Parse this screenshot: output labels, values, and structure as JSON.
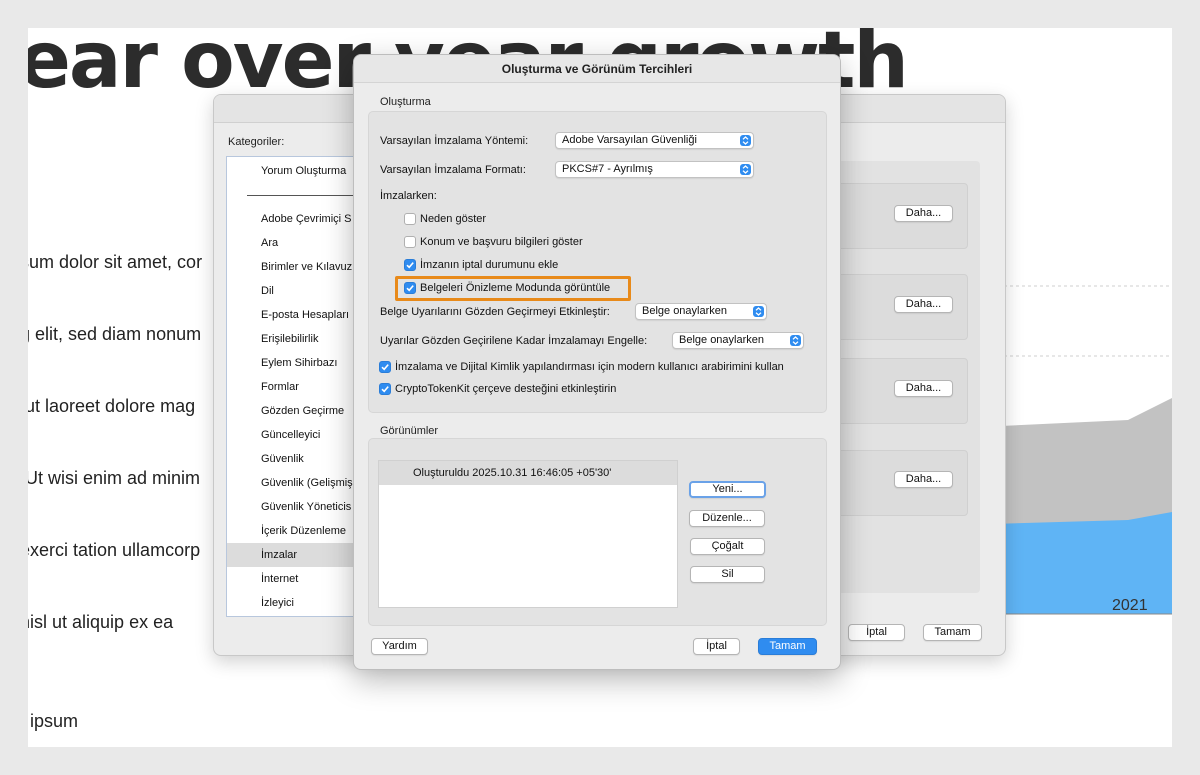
{
  "background_doc": {
    "heading": "ear over year growth",
    "body_lines": [
      "sum dolor sit amet, cor",
      "g elit, sed diam nonum",
      " ut laoreet dolore mag",
      " Ut wisi enim ad minim",
      "exerci tation ullamcorp",
      "nisl ut aliquip ex ea"
    ],
    "footer": "ipsum",
    "chart_year_label": "2021"
  },
  "back_window": {
    "categories_label": "Kategoriler:",
    "categories": [
      "Yorum Oluşturma",
      "Adobe Çevrimiçi S",
      "Ara",
      "Birimler ve Kılavuz",
      "Dil",
      "E-posta Hesapları",
      "Erişilebilirlik",
      "Eylem Sihirbazı",
      "Formlar",
      "Gözden Geçirme",
      "Güncelleyici",
      "Güvenlik",
      "Güvenlik (Gelişmiş",
      "Güvenlik Yöneticis",
      "İçerik Düzenleme",
      "İmzalar",
      "İnternet",
      "İzleyici"
    ],
    "selected_category": "İmzalar",
    "more_buttons": [
      "Daha...",
      "Daha...",
      "Daha...",
      "Daha..."
    ],
    "cancel_label": "İptal",
    "ok_label": "Tamam"
  },
  "dialog": {
    "title": "Oluşturma ve Görünüm Tercihleri",
    "creation_section": "Oluşturma",
    "method_label": "Varsayılan İmzalama Yöntemi:",
    "method_value": "Adobe Varsayılan Güvenliği",
    "format_label": "Varsayılan İmzalama Formatı:",
    "format_value": "PKCS#7 - Ayrılmış",
    "when_signing_label": "İmzalarken:",
    "checks": [
      {
        "label": "Neden göster",
        "checked": false
      },
      {
        "label": "Konum ve başvuru bilgileri göster",
        "checked": false
      },
      {
        "label": "İmzanın iptal durumunu ekle",
        "checked": true
      },
      {
        "label": "Belgeleri Önizleme Modunda görüntüle",
        "checked": true
      }
    ],
    "review_warnings_label": "Belge Uyarılarını Gözden Geçirmeyi Etkinleştir:",
    "review_warnings_value": "Belge onaylarken",
    "block_signing_label": "Uyarılar Gözden Geçirilene Kadar İmzalamayı Engelle:",
    "block_signing_value": "Belge onaylarken",
    "modern_ui_label": "İmzalama ve Dijital Kimlik yapılandırması için modern kullanıcı arabirimini kullan",
    "modern_ui_checked": true,
    "cryptokit_label": "CryptoTokenKit çerçeve desteğini etkinleştirin",
    "cryptokit_checked": true,
    "appearances_section": "Görünümler",
    "appearance_item": "Oluşturuldu 2025.10.31 16:46:05 +05'30'",
    "new_label": "Yeni...",
    "edit_label": "Düzenle...",
    "duplicate_label": "Çoğalt",
    "delete_label": "Sil",
    "help_label": "Yardım",
    "cancel_label": "İptal",
    "ok_label": "Tamam"
  },
  "colors": {
    "accent": "#2f8cf0",
    "highlight": "#e88a1a",
    "chart_gray": "#c2c2c2",
    "chart_blue": "#5fb4f5"
  }
}
